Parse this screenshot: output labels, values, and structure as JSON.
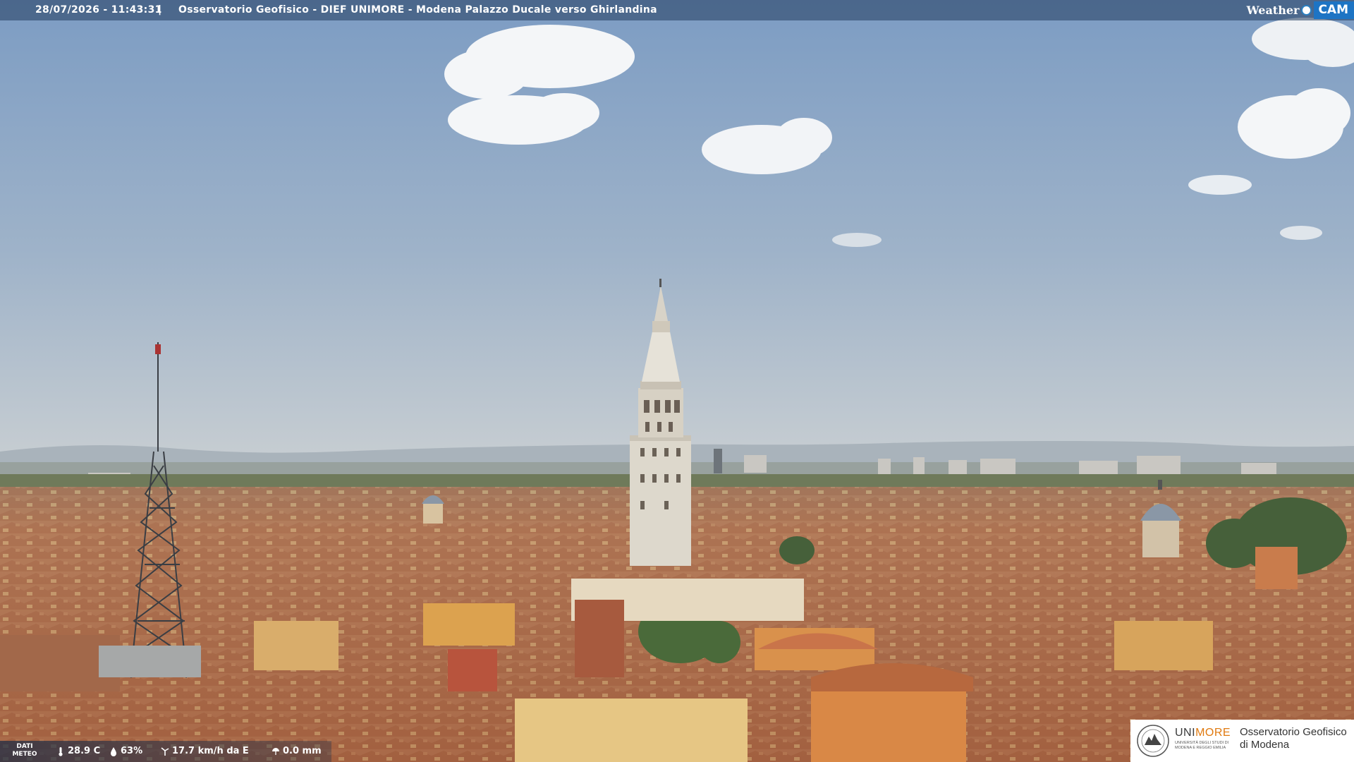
{
  "header": {
    "timestamp": "28/07/2026 - 11:43:31",
    "separator": "|",
    "title": "Osservatorio Geofisico - DIEF UNIMORE - Modena Palazzo Ducale verso Ghirlandina"
  },
  "brand": {
    "weather_label": "Weather",
    "cam_label": "CAM"
  },
  "meteo": {
    "label_line1": "DATI",
    "label_line2": "METEO",
    "temperature": "28.9 C",
    "humidity": "63%",
    "wind": "17.7 km/h da E",
    "rain": "0.0 mm"
  },
  "logo": {
    "uni_part1": "UNI",
    "uni_part2": "MORE",
    "uni_subtitle": "UNIVERSITÀ DEGLI STUDI DI MODENA E REGGIO EMILIA",
    "obs_line1": "Osservatorio Geofisico",
    "obs_line2": "di Modena"
  },
  "colors": {
    "sky_top": "#7c9dc4",
    "sky_horizon": "#c4ccd1",
    "roof": "#b8734a",
    "tower": "#ddd8cc",
    "brand_blue": "#1d74c4",
    "unimore_orange": "#e07a10"
  }
}
